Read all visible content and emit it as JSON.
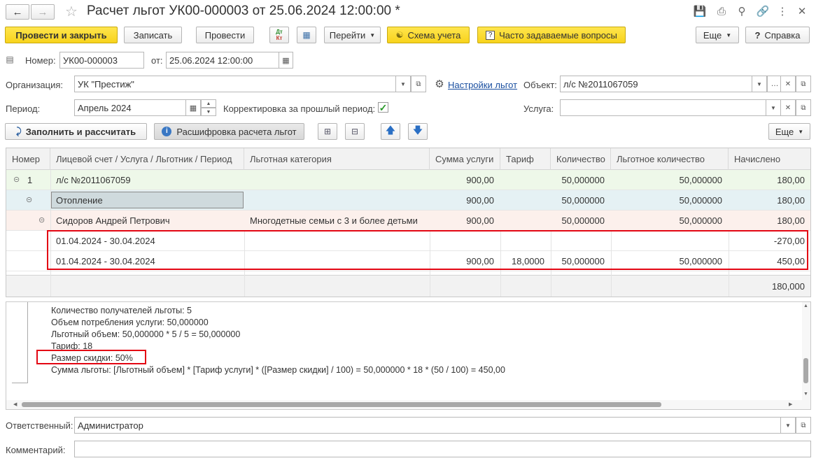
{
  "window": {
    "title": "Расчет льгот УК00-000003 от 25.06.2024 12:00:00 *"
  },
  "toolbar": {
    "post_close": "Провести и закрыть",
    "save": "Записать",
    "post": "Провести",
    "dtkt_top": "Дт",
    "dtkt_bottom": "Кт",
    "goto": "Перейти",
    "scheme": "Схема учета",
    "faq": "Часто задаваемые вопросы",
    "more": "Еще",
    "help": "Справка"
  },
  "header": {
    "number_label": "Номер:",
    "number_value": "УК00-000003",
    "date_label": "от:",
    "date_value": "25.06.2024 12:00:00",
    "org_label": "Организация:",
    "org_value": "УК \"Престиж\"",
    "settings_link": "Настройки льгот",
    "object_label": "Объект:",
    "object_value": "л/с №2011067059",
    "period_label": "Период:",
    "period_value": "Апрель 2024",
    "correction_label": "Корректировка за прошлый период:",
    "correction_checked": true,
    "service_label": "Услуга:",
    "service_value": ""
  },
  "table_toolbar": {
    "fill": "Заполнить и рассчитать",
    "decode": "Расшифровка расчета льгот",
    "more": "Еще"
  },
  "table": {
    "columns": [
      "Номер",
      "Лицевой счет / Услуга / Льготник / Период",
      "Льготная категория",
      "Сумма услуги",
      "Тариф",
      "Количество",
      "Льготное количество",
      "Начислено"
    ],
    "rows": [
      {
        "num": "1",
        "name": "л/с №2011067059",
        "category": "",
        "sum": "900,00",
        "tariff": "",
        "qty": "50,000000",
        "lqty": "50,000000",
        "accrued": "180,00"
      },
      {
        "num": "",
        "name": "Отопление",
        "category": "",
        "sum": "900,00",
        "tariff": "",
        "qty": "50,000000",
        "lqty": "50,000000",
        "accrued": "180,00"
      },
      {
        "num": "",
        "name": "Сидоров Андрей Петрович",
        "category": "Многодетные семьи с 3 и более детьми",
        "sum": "900,00",
        "tariff": "",
        "qty": "50,000000",
        "lqty": "50,000000",
        "accrued": "180,00"
      },
      {
        "num": "",
        "name": "01.04.2024 - 30.04.2024",
        "category": "",
        "sum": "",
        "tariff": "",
        "qty": "",
        "lqty": "",
        "accrued": "-270,00"
      },
      {
        "num": "",
        "name": "01.04.2024 - 30.04.2024",
        "category": "",
        "sum": "900,00",
        "tariff": "18,0000",
        "qty": "50,000000",
        "lqty": "50,000000",
        "accrued": "450,00"
      }
    ],
    "total": "180,000"
  },
  "memo": {
    "lines": [
      "Количество получателей льготы: 5",
      "Объем потребления услуги: 50,000000",
      "Льготный объем: 50,000000 * 5 / 5 = 50,000000",
      "Тариф: 18",
      "Размер скидки: 50%",
      "Сумма льготы: [Льготный объем] * [Тариф услуги] * ([Размер скидки] / 100) = 50,000000 * 18 * (50 / 100) = 450,00"
    ]
  },
  "footer": {
    "responsible_label": "Ответственный:",
    "responsible_value": "Администратор",
    "comment_label": "Комментарий:",
    "comment_value": ""
  },
  "colors": {
    "accent_yellow": "#f8d31c",
    "highlight_red": "#e30613",
    "row_green": "#eef8e9",
    "row_blue": "#e5f1f4",
    "row_pink": "#fcf0ec",
    "link_blue": "#1a4fa0"
  }
}
